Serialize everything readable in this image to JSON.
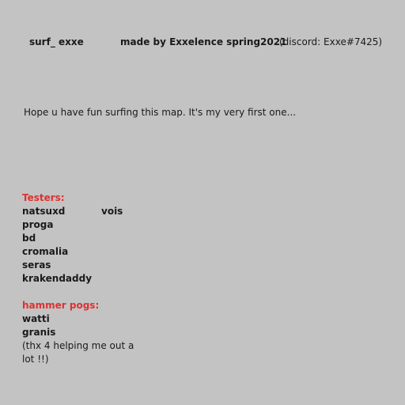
{
  "header": {
    "map_name": "surf_ exxe",
    "credit": "made by Exxelence spring2021",
    "discord": "(discord: Exxe#7425)"
  },
  "message": "Hope u have fun surfing this map. It's my very first one...",
  "testers": {
    "heading": "Testers:",
    "names": [
      "natsuxd",
      "vois",
      "proga",
      "bd",
      "cromalia",
      "seras",
      "krakendaddy"
    ]
  },
  "hammer": {
    "heading": "hammer pogs:",
    "names": [
      "watti",
      "granis"
    ],
    "note_line1": "(thx 4 helping me out a",
    "note_line2": "lot !!)"
  },
  "colors": {
    "background": "#c3c3c3",
    "heading_red": "#e03030",
    "text": "#1a1a1a"
  }
}
